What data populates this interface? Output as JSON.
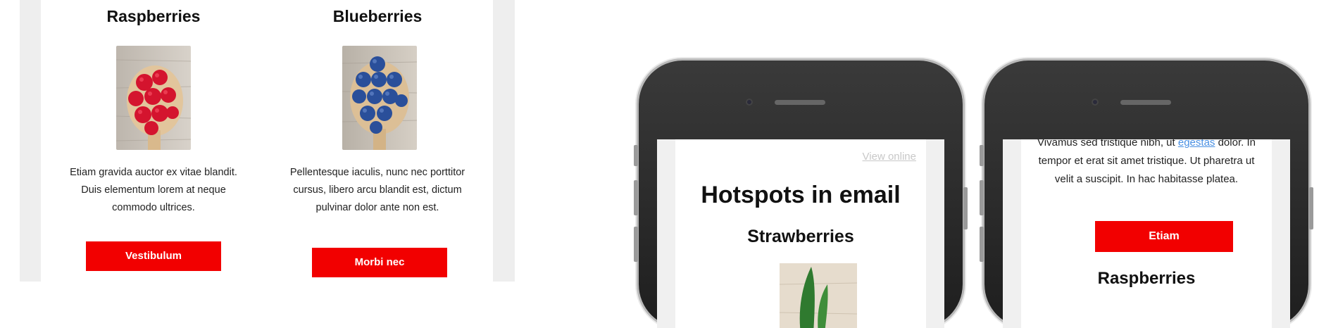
{
  "desktop_email": {
    "products": [
      {
        "name": "Raspberries",
        "image_icon": "raspberries-on-spoon-image",
        "description": "Etiam gravida auctor ex vitae blandit. Duis elementum lorem at neque commodo ultrices.",
        "button_label": "Vestibulum"
      },
      {
        "name": "Blueberries",
        "image_icon": "blueberries-on-spoon-image",
        "description": "Pellentesque iaculis, nunc nec porttitor cursus, libero arcu blandit est, dictum pulvinar dolor ante non est.",
        "button_label": "Morbi nec"
      }
    ]
  },
  "phone_left": {
    "view_online_label": "View online",
    "title": "Hotspots in email",
    "section_title": "Strawberries",
    "image_icon": "strawberries-image"
  },
  "phone_right": {
    "text_partial_top": "Vivamus sed tristique nibh, ut",
    "link_text": "egestas",
    "text_rest": "dolor. In tempor et erat sit amet tristique. Ut pharetra ut velit a suscipit. In hac habitasse platea.",
    "button_label": "Etiam",
    "section_title": "Raspberries"
  },
  "colors": {
    "accent_button": "#f20000",
    "link": "#4a90e2",
    "frame_gray": "#eeeeee",
    "phone_body": "#2b2b2b"
  }
}
